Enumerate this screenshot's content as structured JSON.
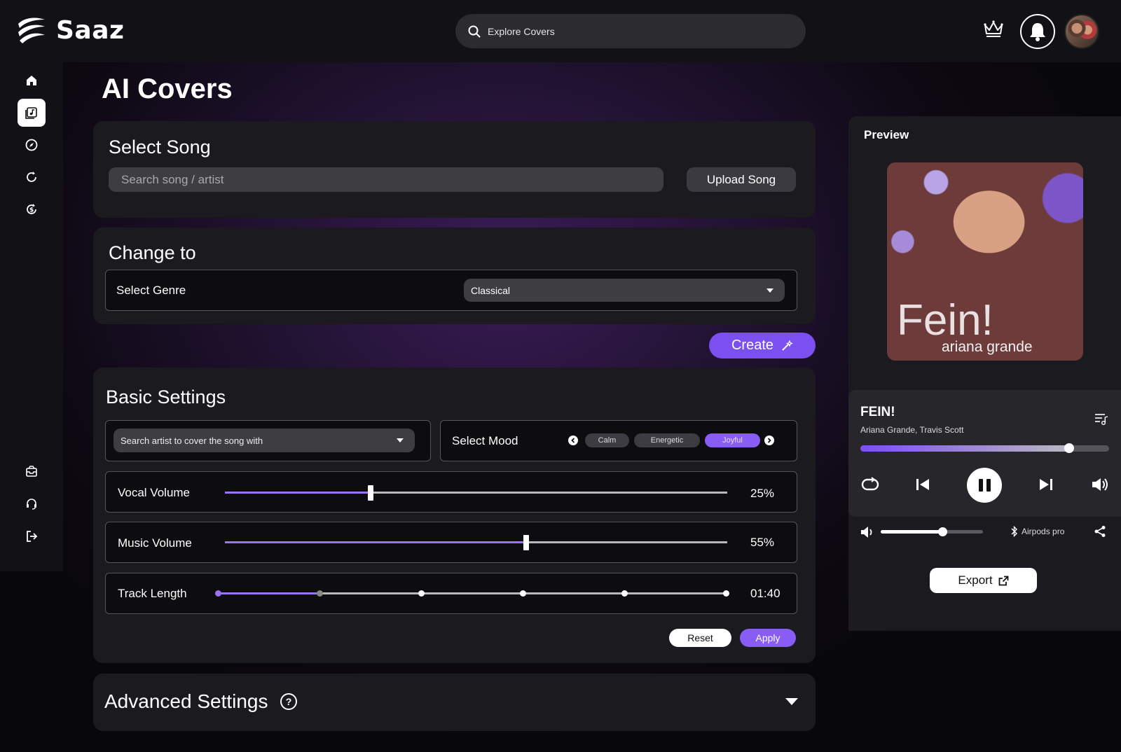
{
  "app": {
    "name": "Saaz"
  },
  "header": {
    "search_placeholder": "Explore Covers"
  },
  "sidebar": {
    "items": [
      {
        "icon": "home-icon"
      },
      {
        "icon": "music-library-icon",
        "active": true
      },
      {
        "icon": "compass-icon"
      },
      {
        "icon": "refresh-icon"
      },
      {
        "icon": "currency-icon"
      },
      {
        "icon": "inbox-icon"
      },
      {
        "icon": "support-icon"
      },
      {
        "icon": "logout-icon"
      }
    ]
  },
  "page": {
    "title": "AI Covers"
  },
  "select_song": {
    "title": "Select Song",
    "search_placeholder": "Search song / artist",
    "upload_label": "Upload Song"
  },
  "change_to": {
    "title": "Change to",
    "genre_label": "Select Genre",
    "genre_value": "Classical"
  },
  "create_label": "Create",
  "basic_settings": {
    "title": "Basic Settings",
    "artist_select_value": "Search artist to cover the song with",
    "mood_label": "Select Mood",
    "moods": [
      "Calm",
      "Energetic",
      "Joyful"
    ],
    "selected_mood": "Joyful",
    "vocal_volume": {
      "label": "Vocal Volume",
      "value": "25%",
      "level": 0.29
    },
    "music_volume": {
      "label": "Music Volume",
      "value": "55%",
      "level": 0.6
    },
    "track_length": {
      "label": "Track Length",
      "value": "01:40"
    },
    "reset_label": "Reset",
    "apply_label": "Apply"
  },
  "advanced_settings": {
    "title": "Advanced Settings",
    "help": "?"
  },
  "preview": {
    "label": "Preview",
    "cover_title": "Fein!",
    "cover_artist": "ariana grande",
    "track_title": "FEIN!",
    "track_artists": "Ariana Grande, Travis Scott",
    "progress": 0.84,
    "volume": 0.6,
    "device": "Airpods pro",
    "export_label": "Export"
  },
  "colors": {
    "accent": "#7b4ff0",
    "panel": "#1b1b1f",
    "bar": "#111116"
  }
}
